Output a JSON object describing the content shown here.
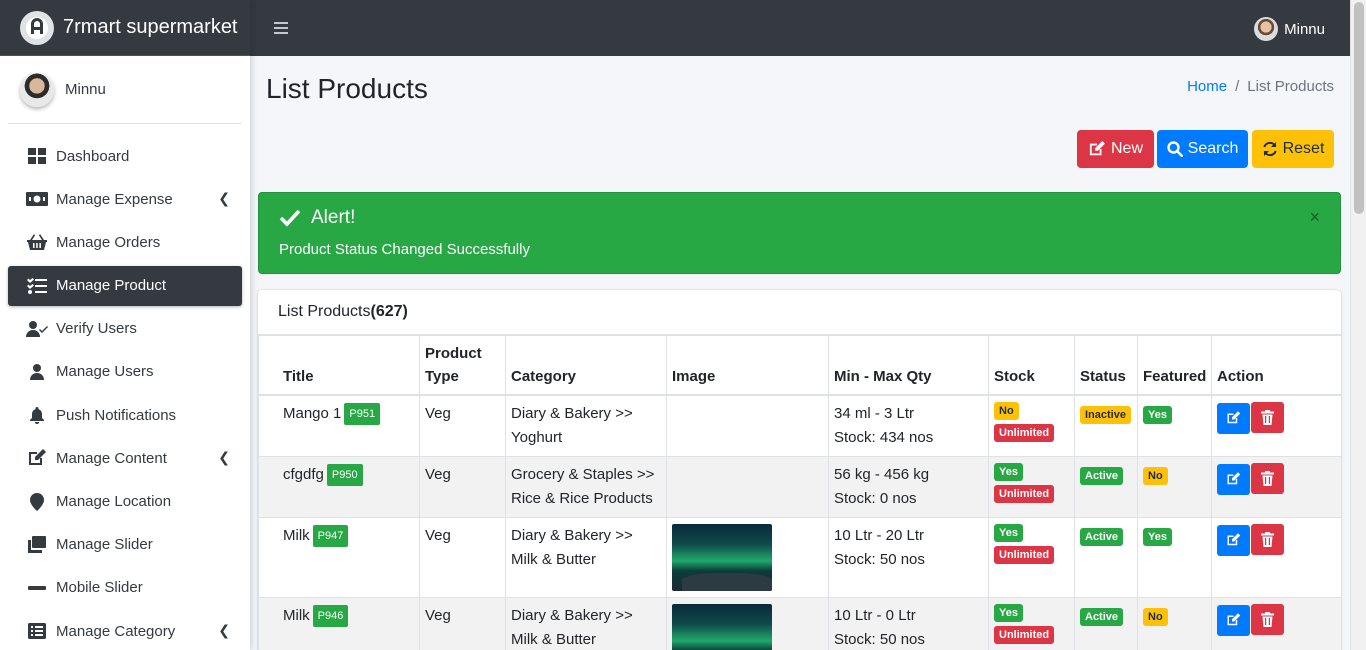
{
  "brand": {
    "name": "7rmart supermarket"
  },
  "user": {
    "name": "Minnu"
  },
  "topbar": {
    "user_name": "Minnu"
  },
  "sidebar": {
    "items": [
      {
        "label": "Dashboard",
        "icon": "dashboard-icon",
        "active": false,
        "has_children": false
      },
      {
        "label": "Manage Expense",
        "icon": "money-icon",
        "active": false,
        "has_children": true
      },
      {
        "label": "Manage Orders",
        "icon": "basket-icon",
        "active": false,
        "has_children": false
      },
      {
        "label": "Manage Product",
        "icon": "tasks-icon",
        "active": true,
        "has_children": false
      },
      {
        "label": "Verify Users",
        "icon": "user-check-icon",
        "active": false,
        "has_children": false
      },
      {
        "label": "Manage Users",
        "icon": "user-icon",
        "active": false,
        "has_children": false
      },
      {
        "label": "Push Notifications",
        "icon": "bell-icon",
        "active": false,
        "has_children": false
      },
      {
        "label": "Manage Content",
        "icon": "edit-icon",
        "active": false,
        "has_children": true
      },
      {
        "label": "Manage Location",
        "icon": "map-marker-icon",
        "active": false,
        "has_children": false
      },
      {
        "label": "Manage Slider",
        "icon": "clone-icon",
        "active": false,
        "has_children": false
      },
      {
        "label": "Mobile Slider",
        "icon": "minus-icon",
        "active": false,
        "has_children": false
      },
      {
        "label": "Manage Category",
        "icon": "list-alt-icon",
        "active": false,
        "has_children": true
      }
    ]
  },
  "page": {
    "title": "List Products",
    "breadcrumb": {
      "home": "Home",
      "separator": "/",
      "current": "List Products"
    }
  },
  "actions": {
    "new": "New",
    "search": "Search",
    "reset": "Reset"
  },
  "alert": {
    "title": "Alert!",
    "message": "Product Status Changed Successfully",
    "close": "×"
  },
  "card": {
    "title": "List Products",
    "count": "(627)"
  },
  "table": {
    "headers": [
      "Title",
      "Product Type",
      "Category",
      "Image",
      "Min - Max Qty",
      "Stock",
      "Status",
      "Featured",
      "Action"
    ],
    "rows": [
      {
        "title": "Mango 1",
        "code": "P951",
        "type": "Veg",
        "category": "Diary & Bakery >> Yoghurt",
        "has_image": false,
        "qty": "34 ml - 3 Ltr",
        "stock": "Stock: 434 nos",
        "stock_flag": "No",
        "stock_flag_color": "#ffc107",
        "unlimited": "Unlimited",
        "status": "Inactive",
        "status_color": "#ffc107",
        "featured": "Yes",
        "featured_color": "#28a745"
      },
      {
        "title": "cfgdfg",
        "code": "P950",
        "type": "Veg",
        "category": "Grocery & Staples >> Rice & Rice Products",
        "has_image": false,
        "qty": "56 kg - 456 kg",
        "stock": "Stock: 0 nos",
        "stock_flag": "Yes",
        "stock_flag_color": "#28a745",
        "unlimited": "Unlimited",
        "status": "Active",
        "status_color": "#28a745",
        "featured": "No",
        "featured_color": "#ffc107"
      },
      {
        "title": "Milk",
        "code": "P947",
        "type": "Veg",
        "category": "Diary & Bakery >> Milk & Butter",
        "has_image": true,
        "qty": "10 Ltr - 20 Ltr",
        "stock": "Stock: 50 nos",
        "stock_flag": "Yes",
        "stock_flag_color": "#28a745",
        "unlimited": "Unlimited",
        "status": "Active",
        "status_color": "#28a745",
        "featured": "Yes",
        "featured_color": "#28a745"
      },
      {
        "title": "Milk",
        "code": "P946",
        "type": "Veg",
        "category": "Diary & Bakery >> Milk & Butter",
        "has_image": true,
        "qty": "10 Ltr - 0 Ltr",
        "stock": "Stock: 50 nos",
        "stock_flag": "Yes",
        "stock_flag_color": "#28a745",
        "unlimited": "Unlimited",
        "status": "Active",
        "status_color": "#28a745",
        "featured": "No",
        "featured_color": "#ffc107"
      }
    ]
  },
  "colors": {
    "primary": "#007bff",
    "danger": "#dc3545",
    "success": "#28a745",
    "warning": "#ffc107",
    "dark": "#343a40"
  }
}
